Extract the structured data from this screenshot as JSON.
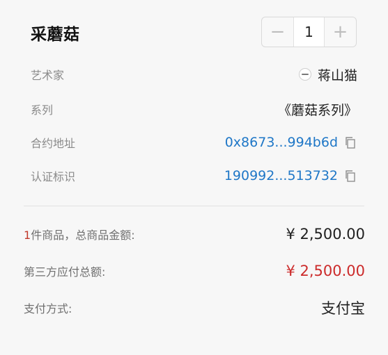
{
  "product": {
    "title": "采蘑菇",
    "quantity": "1",
    "minus_symbol": "−",
    "plus_symbol": "+"
  },
  "details": {
    "artist_label": "艺术家",
    "artist_value": "蒋山猫",
    "series_label": "系列",
    "series_value": "《蘑菇系列》",
    "contract_label": "合约地址",
    "contract_value": "0x8673...994b6d",
    "token_label": "认证标识",
    "token_value": "190992...513732"
  },
  "summary": {
    "count": "1",
    "count_suffix": "件商品，总商品金额:",
    "goods_amount": "¥ 2,500.00",
    "third_party_label": "第三方应付总额:",
    "third_party_amount": "¥ 2,500.00",
    "payment_label": "支付方式:",
    "payment_value": "支付宝"
  },
  "colors": {
    "link": "#1f77c7",
    "price_red": "#cc2b2b",
    "count_red": "#c0392b"
  },
  "icons": {
    "copy": "copy-icon",
    "avatar": "artist-avatar"
  }
}
